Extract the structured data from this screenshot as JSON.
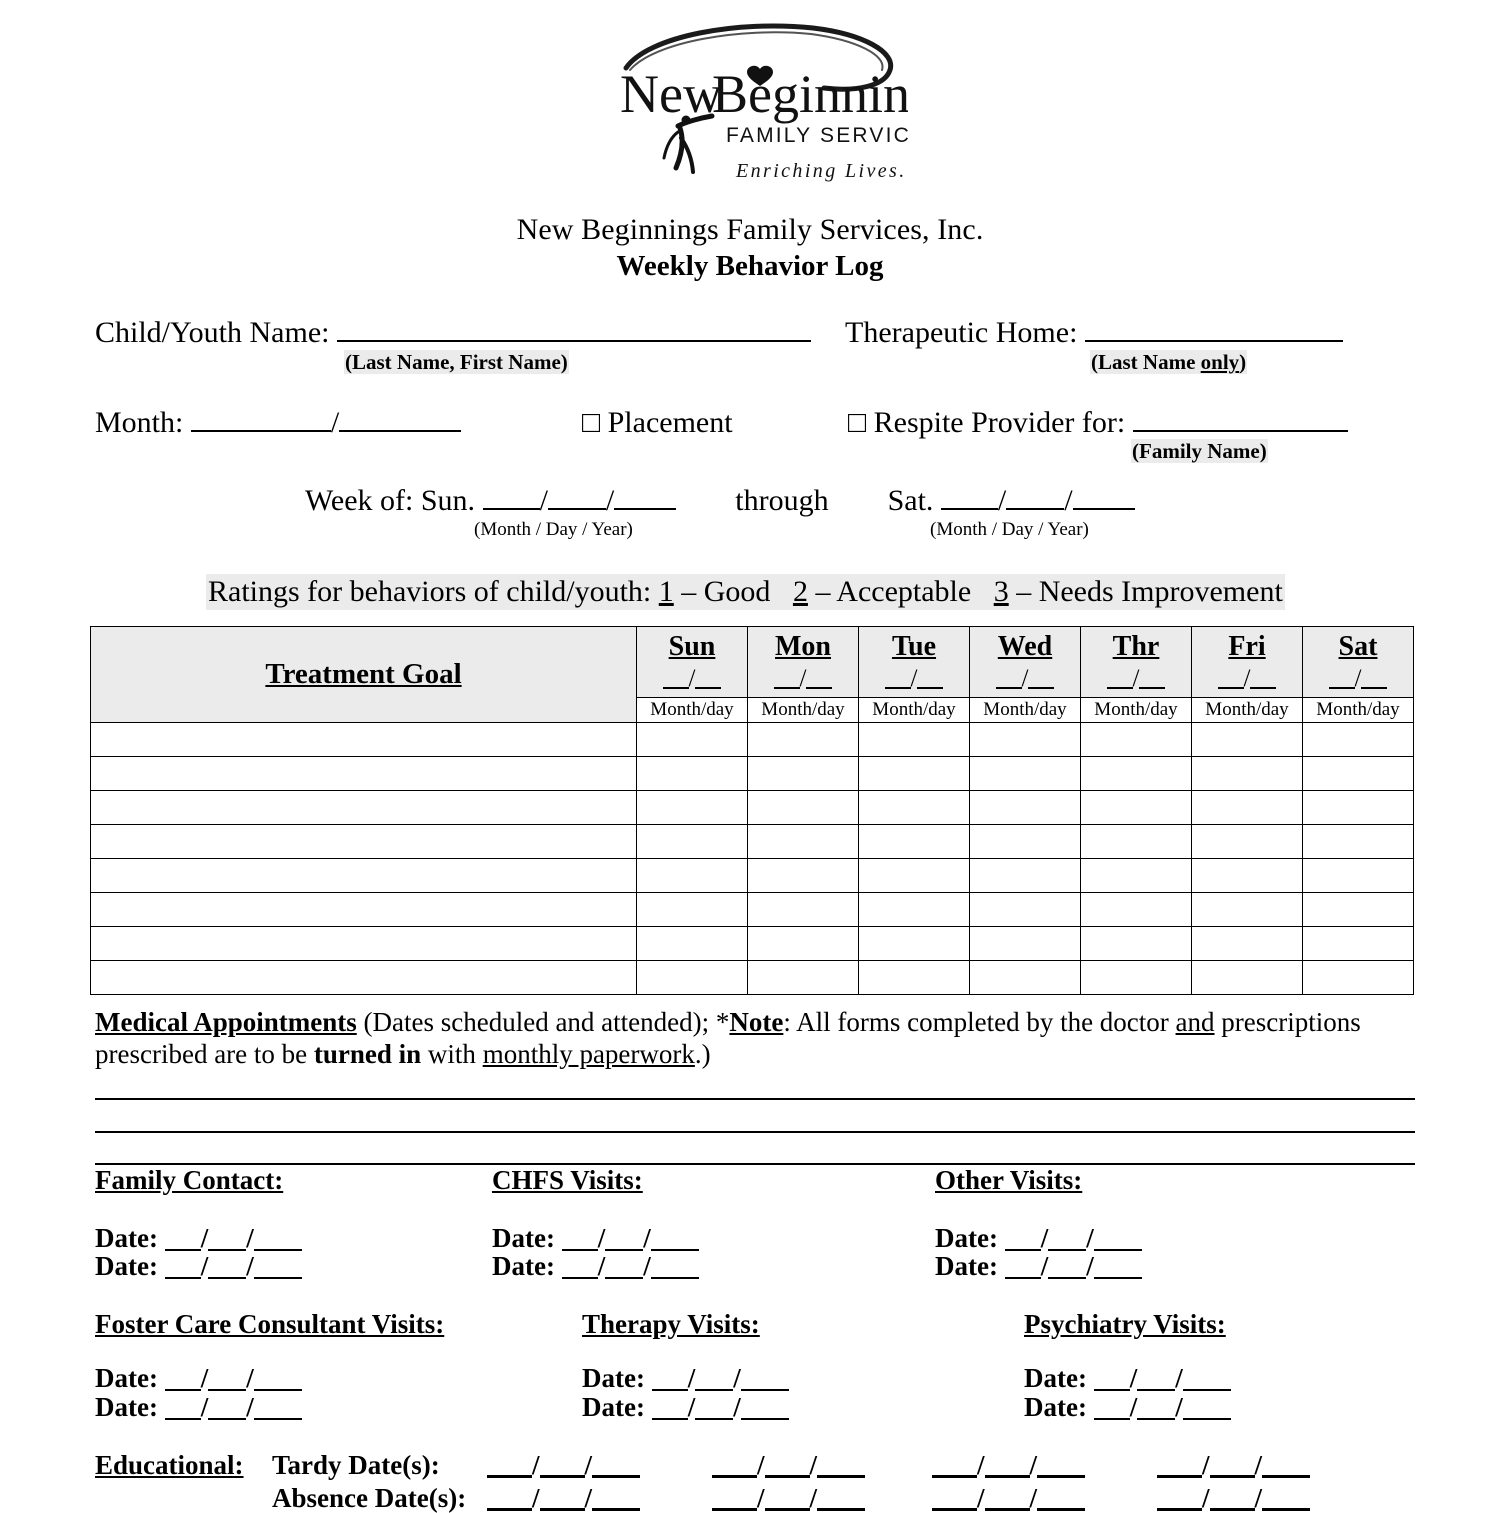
{
  "logo": {
    "name": "New Beginnings",
    "subtitle": "FAMILY SERVICES",
    "tagline": "Enriching Lives."
  },
  "header": {
    "organization": "New Beginnings Family Services, Inc.",
    "document_title": "Weekly Behavior Log"
  },
  "fields": {
    "child_name_label": "Child/Youth Name:",
    "child_name_value": "",
    "child_name_hint": "(Last Name, First Name)",
    "therapeutic_home_label": "Therapeutic Home:",
    "therapeutic_home_value": "",
    "therapeutic_home_hint_pre": "(Last Name ",
    "therapeutic_home_hint_u": "only",
    "therapeutic_home_hint_post": ")",
    "month_label": "Month:",
    "month_value": "",
    "month_year_value": "",
    "placement_checkbox": "□",
    "placement_label": "Placement",
    "respite_checkbox": "□",
    "respite_label": "Respite Provider for:",
    "respite_value": "",
    "respite_hint": "(Family Name)"
  },
  "week_of": {
    "prefix": "Week of: Sun.",
    "through": "through",
    "sat_prefix": "Sat.",
    "sun_month": "",
    "sun_day": "",
    "sun_year": "",
    "sat_month": "",
    "sat_day": "",
    "sat_year": "",
    "caption": "(Month /   Day   /  Year)"
  },
  "ratings": {
    "prefix": "Ratings for behaviors of child/youth:",
    "items": [
      {
        "number": "1",
        "label": "– Good"
      },
      {
        "number": "2",
        "label": "– Acceptable"
      },
      {
        "number": "3",
        "label": "– Needs Improvement"
      }
    ]
  },
  "table": {
    "goal_header": "Treatment Goal",
    "day_sub_label": "Month/day",
    "days": [
      "Sun",
      "Mon",
      "Tue",
      "Wed",
      "Thr",
      "Fri",
      "Sat"
    ],
    "body_row_count": 8
  },
  "medical_note": {
    "title": "Medical Appointments",
    "part1": " (Dates scheduled and attended); *",
    "note_word": "Note",
    "part2": ": All forms completed by the doctor ",
    "and_word": "and",
    "part3": " prescriptions prescribed are to be ",
    "turned_in": "turned in",
    "part4": " with ",
    "monthly_paperwork": "monthly paperwork",
    "part5": ".)"
  },
  "write_lines": 3,
  "visits": {
    "date_label": "Date:",
    "sections": [
      {
        "title": "Family Contact:",
        "rows": 2
      },
      {
        "title": "CHFS Visits:",
        "rows": 2
      },
      {
        "title": "Other Visits:",
        "rows": 2
      },
      {
        "title": "Foster Care Consultant Visits:",
        "rows": 2
      },
      {
        "title": "Therapy Visits:",
        "rows": 2
      },
      {
        "title": "Psychiatry Visits:",
        "rows": 2
      }
    ]
  },
  "educational": {
    "title": "Educational:",
    "tardy_label": "Tardy Date(s):",
    "absence_label": "Absence Date(s):",
    "date_slots": 4
  },
  "colors": {
    "highlight": "#ebebeb",
    "header_fill": "#ebebeb",
    "ink": "#000000",
    "paper": "#ffffff"
  }
}
